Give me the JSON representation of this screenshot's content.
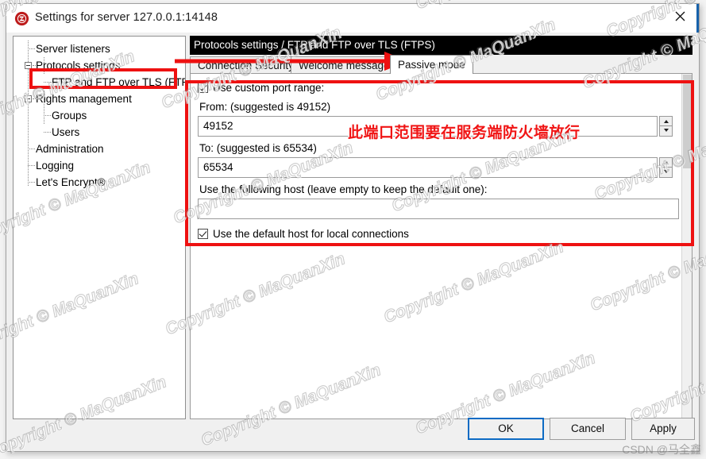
{
  "window": {
    "title": "Settings for server 127.0.0.1:14148",
    "icon": "filezilla-server-icon",
    "close_label": "✕"
  },
  "sidebar": {
    "items": [
      {
        "label": "Server listeners",
        "level": 0,
        "expander": false,
        "selected": false
      },
      {
        "label": "Protocols settings",
        "level": 0,
        "expander": true,
        "selected": false
      },
      {
        "label": "FTP and FTP over TLS (FTPS)",
        "level": 1,
        "expander": false,
        "selected": true
      },
      {
        "label": "Rights management",
        "level": 0,
        "expander": true,
        "selected": false
      },
      {
        "label": "Groups",
        "level": 1,
        "expander": false,
        "selected": false
      },
      {
        "label": "Users",
        "level": 1,
        "expander": false,
        "selected": false
      },
      {
        "label": "Administration",
        "level": 0,
        "expander": false,
        "selected": false
      },
      {
        "label": "Logging",
        "level": 0,
        "expander": false,
        "selected": false
      },
      {
        "label": "Let's Encrypt®",
        "level": 0,
        "expander": false,
        "selected": false
      }
    ]
  },
  "main": {
    "breadcrumb": "Protocols settings / FTP and FTP over TLS (FTPS)",
    "tabs": [
      {
        "label": "Connection Security",
        "active": false
      },
      {
        "label": "Welcome message",
        "active": false
      },
      {
        "label": "Passive mode",
        "active": true
      }
    ],
    "form": {
      "use_custom_port_range_label": "Use custom port range:",
      "use_custom_port_range_checked": true,
      "from_label": "From: (suggested is 49152)",
      "from_value": "49152",
      "to_label": "To: (suggested is 65534)",
      "to_value": "65534",
      "host_label": "Use the following host (leave empty to keep the default one):",
      "host_value": "",
      "host_placeholder": "",
      "default_host_label": "Use the default host for local connections",
      "default_host_checked": true
    }
  },
  "buttons": {
    "ok": "OK",
    "cancel": "Cancel",
    "apply": "Apply"
  },
  "annotations": {
    "note_text": "此端口范围要在服务端防火墙放行",
    "color": "#ee1111"
  },
  "watermark": {
    "text": "Copyright © MaQuanXin",
    "footer": "CSDN @马全鑫"
  }
}
